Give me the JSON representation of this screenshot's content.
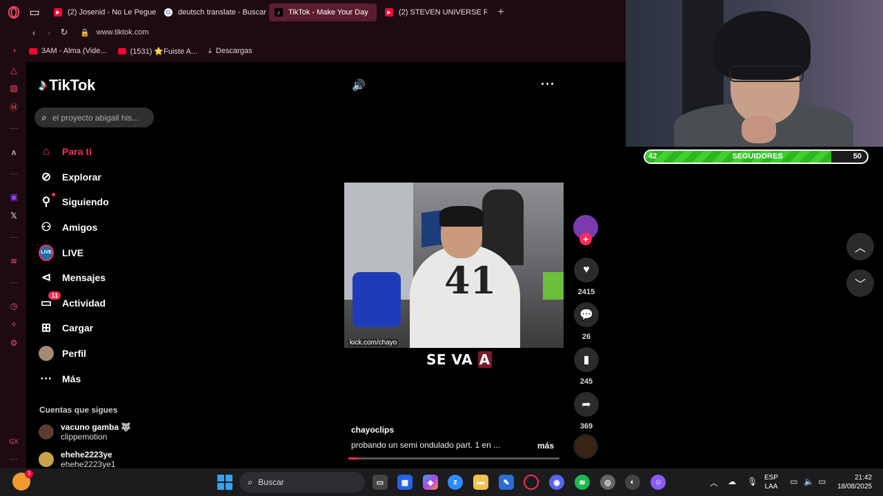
{
  "browser": {
    "tabs": [
      {
        "label": "(2) Josenid - No Le Pegue",
        "favicon": "youtube-icon"
      },
      {
        "label": "deutsch translate - Buscar",
        "favicon": "google-icon"
      },
      {
        "label": "TikTok - Make Your Day",
        "favicon": "tiktok-icon",
        "active": true
      },
      {
        "label": "(2) STEVEN UNIVERSE RAP",
        "favicon": "youtube-icon"
      }
    ],
    "url": "www.tiktok.com",
    "bookmarks": [
      {
        "label": "3AM - Alma (Vide...",
        "icon": "youtube-icon"
      },
      {
        "label": "(1531) ⭐Fuiste A...",
        "icon": "youtube-icon"
      },
      {
        "label": "Descargas",
        "icon": "download-icon"
      }
    ]
  },
  "tiktok": {
    "logo_text": "TikTok",
    "search_placeholder": "el proyecto abigail his...",
    "nav": [
      {
        "label": "Para ti",
        "icon": "home-icon"
      },
      {
        "label": "Explorar",
        "icon": "compass-icon"
      },
      {
        "label": "Siguiendo",
        "icon": "following-icon"
      },
      {
        "label": "Amigos",
        "icon": "friends-icon"
      },
      {
        "label": "LIVE",
        "icon": "live-icon"
      },
      {
        "label": "Mensajes",
        "icon": "send-icon"
      },
      {
        "label": "Actividad",
        "icon": "activity-icon",
        "badge": "11"
      },
      {
        "label": "Cargar",
        "icon": "upload-icon"
      },
      {
        "label": "Perfil",
        "icon": "profile-avatar"
      },
      {
        "label": "Más",
        "icon": "more-icon"
      }
    ],
    "following_title": "Cuentas que sigues",
    "following": [
      {
        "name": "vacuno gamba 🐺",
        "handle": "clippemotion"
      },
      {
        "name": "ehehe2223ye",
        "handle": "ehehe2223ye1"
      }
    ],
    "video": {
      "watermark": "kick.com/chayo",
      "caption_part1": "SE VA ",
      "caption_highlight": "A",
      "author": "chayoclips",
      "description": "probando un semi ondulado part. 1 en ...",
      "more_label": "más",
      "progress": 0.05
    },
    "actions": {
      "likes": "2415",
      "comments": "26",
      "saves": "245",
      "shares": "369"
    }
  },
  "stream_overlay": {
    "goal_current": "42",
    "goal_label": "SEGUIDORES",
    "goal_max": "50",
    "goal_fraction": 0.84
  },
  "taskbar": {
    "search_label": "Buscar",
    "notification_badge": "3",
    "lang_line1": "ESP",
    "lang_line2": "LAA",
    "time": "21:42",
    "date": "18/08/2025"
  },
  "colors": {
    "accent": "#fe2c55",
    "browser_bg": "#1e0b12",
    "active_tab": "#5b1d2f",
    "goal_green": "#3ed12f"
  }
}
